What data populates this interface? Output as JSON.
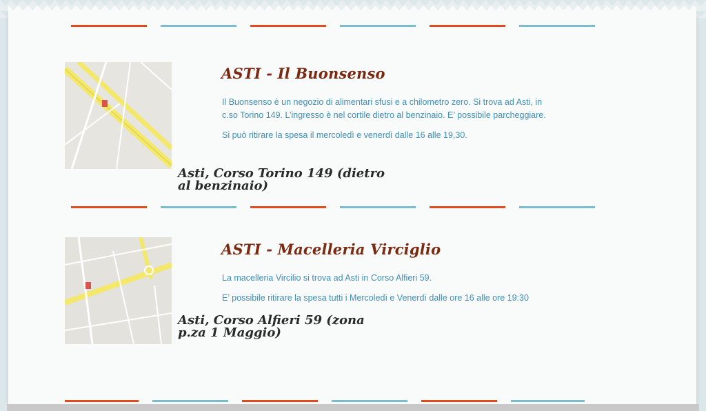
{
  "entries": [
    {
      "title": "ASTI - Il Buonsenso",
      "paragraphs": [
        "Il Buonsenso è un negozio di alimentari sfusi e a chilometro zero. Si trova ad Asti, in c.so Torino 149. L’ingresso è nel cortile dietro al benzinaio. E’ possibile parcheggiare.",
        "Si può ritirare la spesa il mercoledì e venerdì dalle 16 alle 19,30."
      ],
      "address": "Asti, Corso Torino 149 (dietro al benzinaio)",
      "map_icon": "map-thumbnail-icon"
    },
    {
      "title": "ASTI - Macelleria Virciglio",
      "paragraphs": [
        "La macelleria Vircilio si trova ad Asti in Corso Alfieri 59.",
        "E’ possibile ritirare la spesa tutti i Mercoledì e Venerdì dalle ore 16 alle ore 19:30"
      ],
      "address": "Asti, Corso Alfieri 59 (zona p.za 1 Maggio)",
      "map_icon": "map-thumbnail-icon"
    }
  ],
  "colors": {
    "divider_red": "#e14b1d",
    "divider_blue": "#79bccc",
    "title": "#7a2a10",
    "text": "#3f8fb6"
  }
}
